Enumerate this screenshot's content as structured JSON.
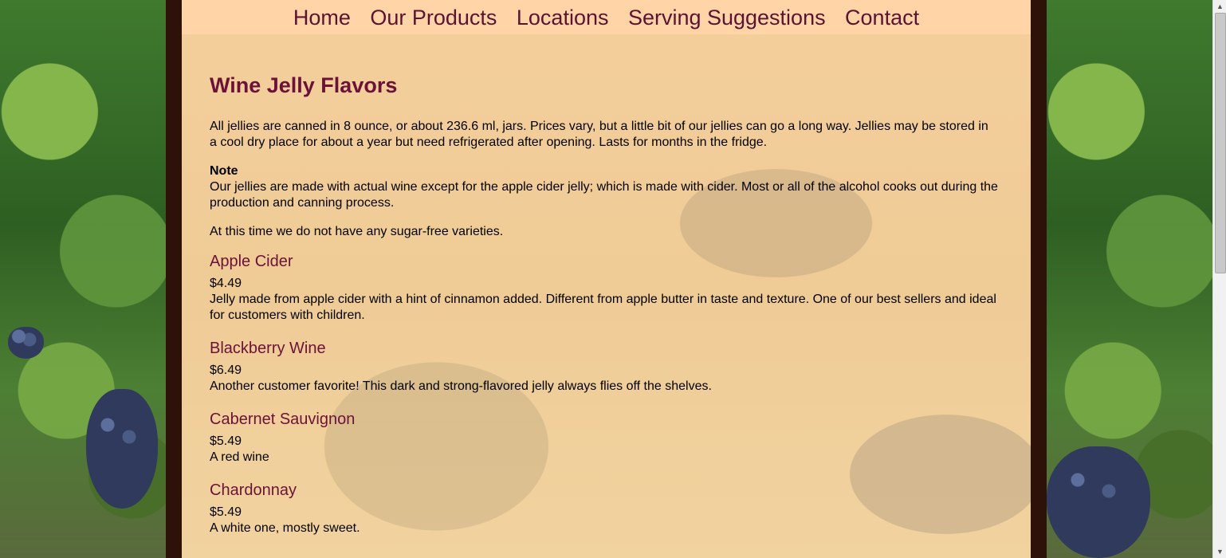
{
  "nav": {
    "items": [
      "Home",
      "Our Products",
      "Locations",
      "Serving Suggestions",
      "Contact"
    ]
  },
  "page": {
    "title": "Wine Jelly Flavors",
    "intro": "All jellies are canned in 8 ounce, or about 236.6 ml, jars. Prices vary, but a little bit of our jellies can go a long way. Jellies may be stored in a cool dry place for about a year but need refrigerated after opening. Lasts for months in the fridge.",
    "note_title": "Note",
    "note_text": "Our jellies are made with actual wine except for the apple cider jelly; which is made with cider. Most or all of the alcohol cooks out during the production and canning process.",
    "sugar_free": "At this time we do not have any sugar-free varieties."
  },
  "products": [
    {
      "name": "Apple Cider",
      "price": "$4.49",
      "desc": "Jelly made from apple cider with a hint of cinnamon added. Different from apple butter in taste and texture. One of our best sellers and ideal for customers with children."
    },
    {
      "name": "Blackberry Wine",
      "price": "$6.49",
      "desc": "Another customer favorite! This dark and strong-flavored jelly always flies off the shelves."
    },
    {
      "name": "Cabernet Sauvignon",
      "price": "$5.49",
      "desc": "A red wine"
    },
    {
      "name": "Chardonnay",
      "price": "$5.49",
      "desc": "A white one, mostly sweet."
    }
  ],
  "colors": {
    "heading": "#6b1238",
    "nav_bg": "#ffd5a8",
    "frame": "#2e120a"
  }
}
